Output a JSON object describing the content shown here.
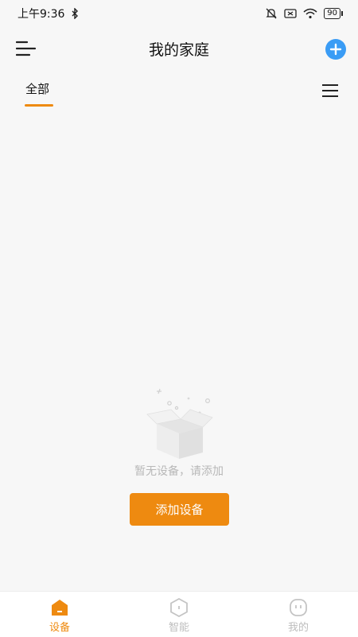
{
  "status_bar": {
    "time": "上午9:36",
    "battery": "90",
    "icons": [
      "bluetooth-icon",
      "mute-icon",
      "sim-icon",
      "wifi-icon",
      "battery-icon"
    ]
  },
  "header": {
    "title": "我的家庭"
  },
  "tabs": {
    "active_label": "全部"
  },
  "empty_state": {
    "message": "暂无设备，请添加",
    "button_label": "添加设备"
  },
  "bottom_nav": {
    "items": [
      {
        "label": "设备",
        "icon": "home-icon",
        "active": true
      },
      {
        "label": "智能",
        "icon": "hexagon-icon",
        "active": false
      },
      {
        "label": "我的",
        "icon": "face-icon",
        "active": false
      }
    ]
  },
  "colors": {
    "accent": "#ee8a10",
    "add_button": "#3a9cf5",
    "background": "#f7f7f7"
  }
}
